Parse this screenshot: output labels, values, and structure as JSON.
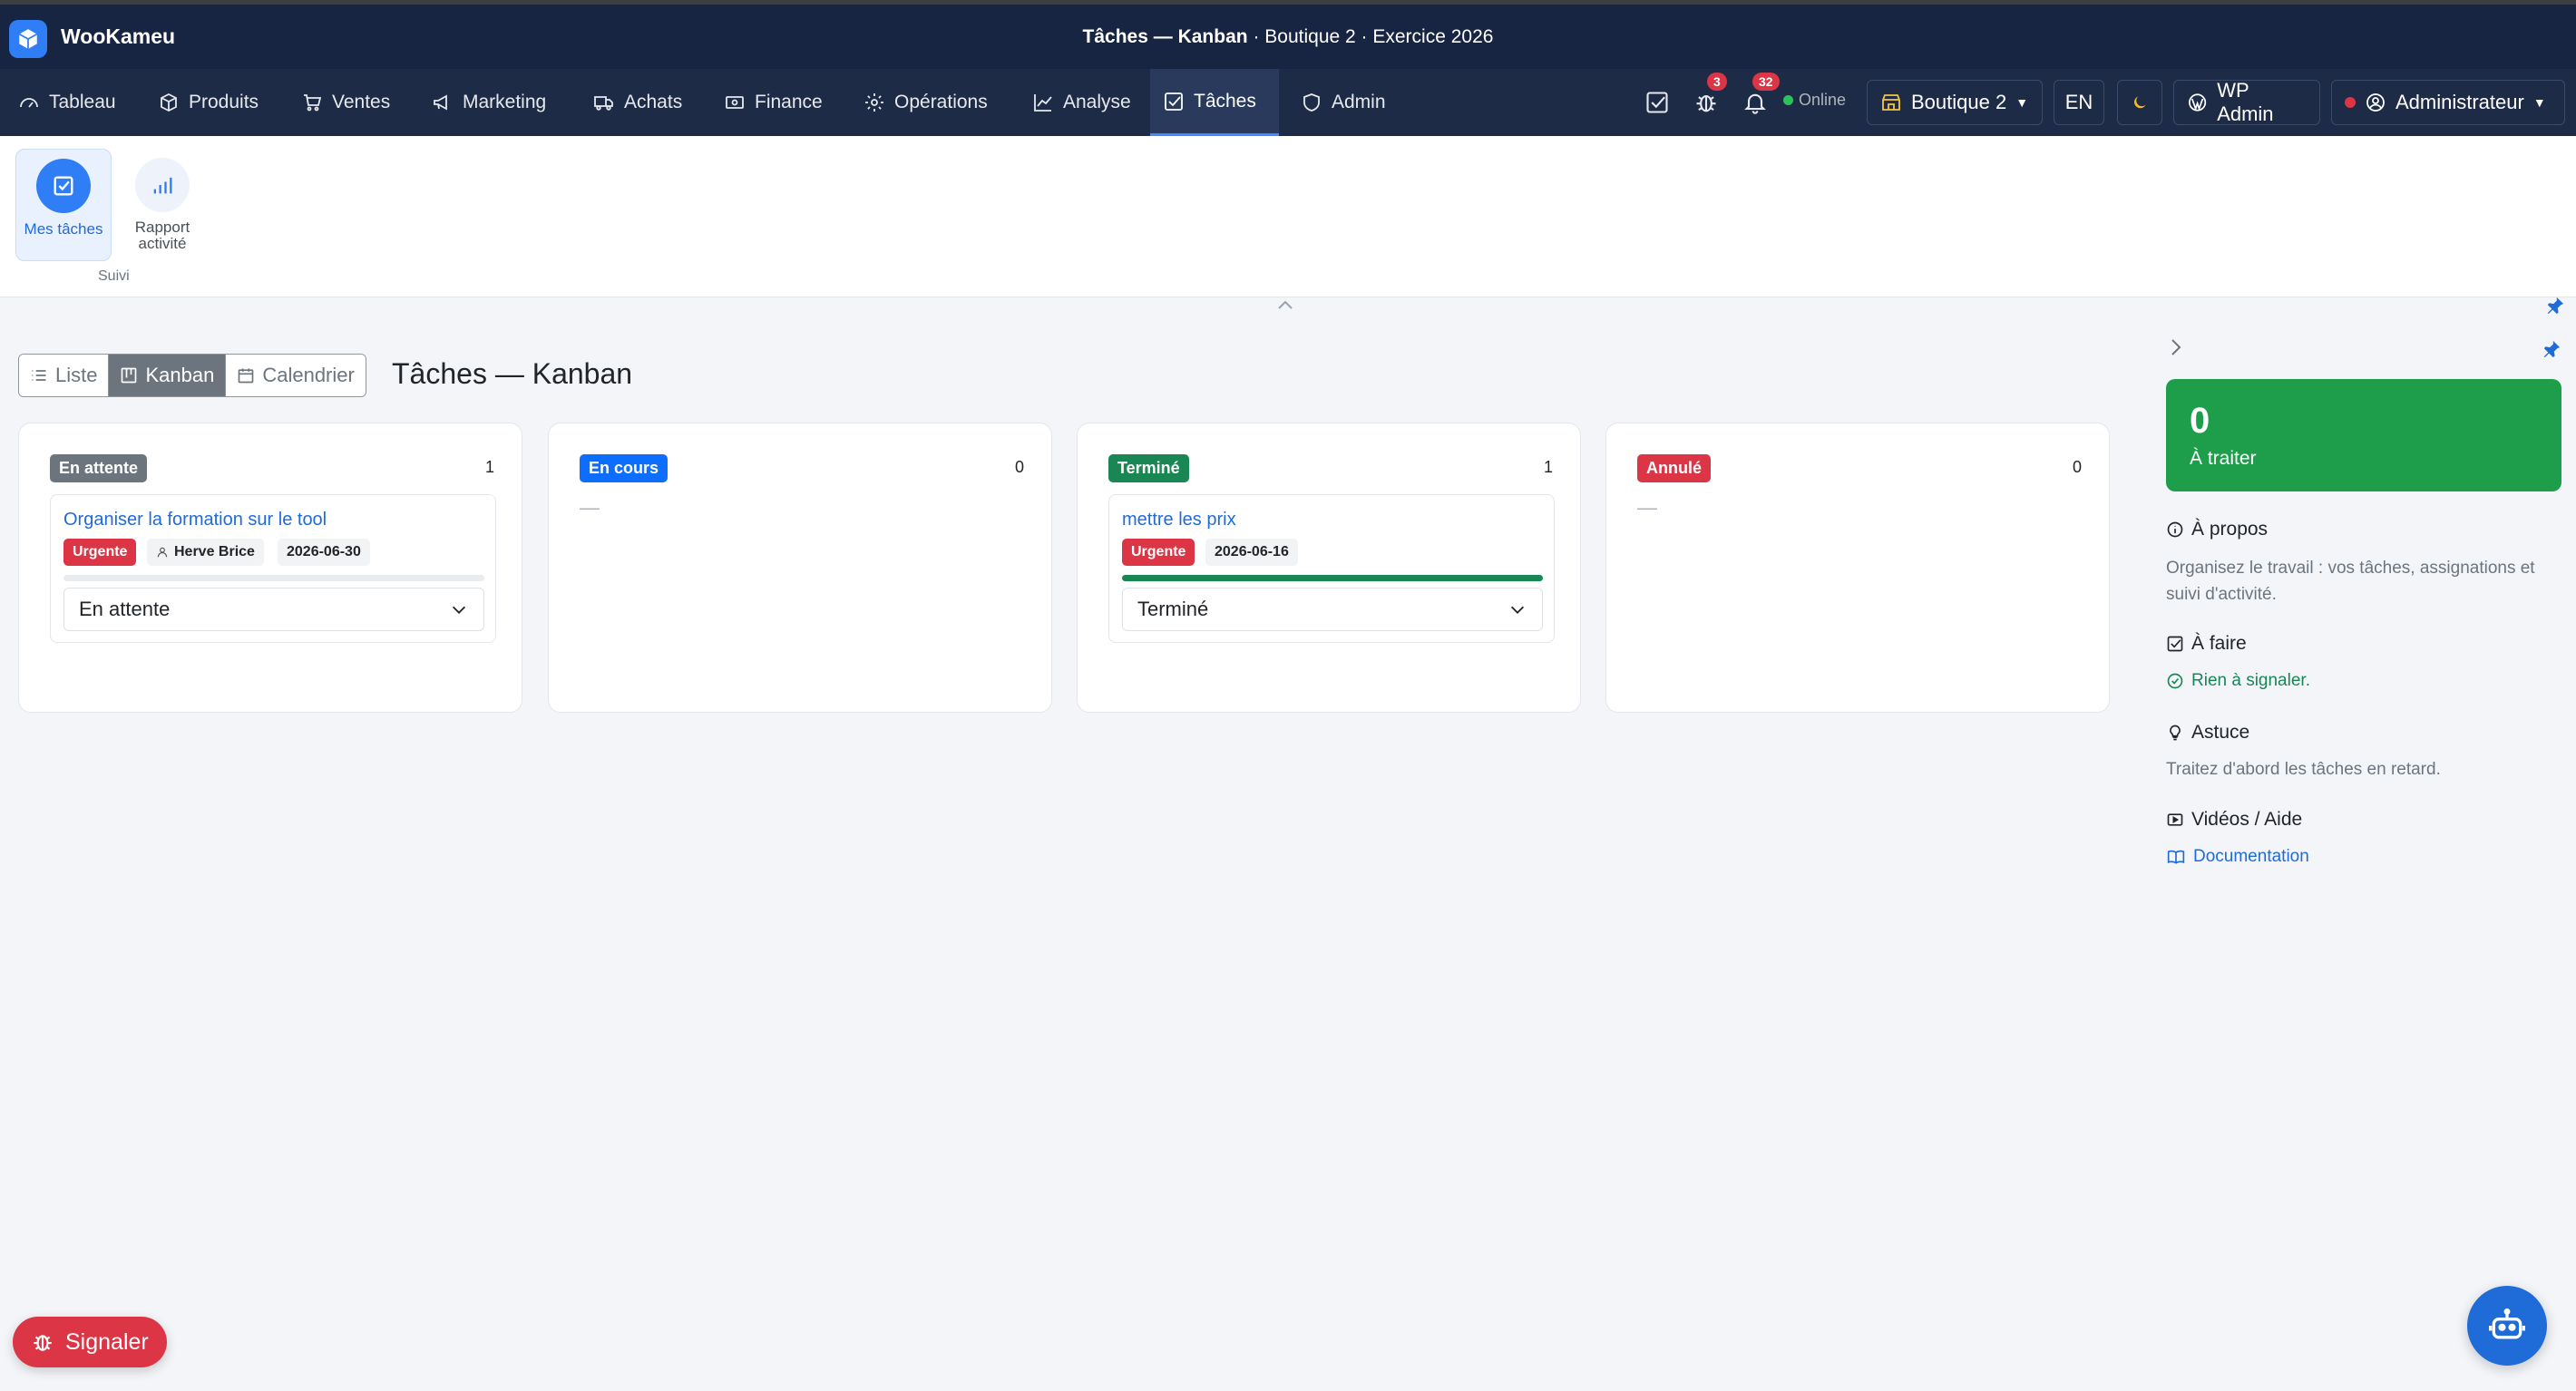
{
  "app": {
    "name": "WooKameu"
  },
  "window": {
    "title_bold": "Tâches — Kanban",
    "title_rest": " · Boutique 2 · Exercice 2026"
  },
  "nav": {
    "items": [
      {
        "label": "Tableau",
        "icon": "gauge-icon"
      },
      {
        "label": "Produits",
        "icon": "box-icon"
      },
      {
        "label": "Ventes",
        "icon": "cart-icon"
      },
      {
        "label": "Marketing",
        "icon": "megaphone-icon"
      },
      {
        "label": "Achats",
        "icon": "truck-icon"
      },
      {
        "label": "Finance",
        "icon": "cash-icon"
      },
      {
        "label": "Opérations",
        "icon": "gear-icon"
      },
      {
        "label": "Analyse",
        "icon": "chart-line-icon"
      },
      {
        "label": "Tâches",
        "icon": "check-square-icon"
      },
      {
        "label": "Admin",
        "icon": "shield-icon"
      }
    ],
    "active": "Tâches",
    "bug_badge": "3",
    "bell_badge": "32",
    "online": "Online",
    "store": "Boutique 2",
    "lang": "EN",
    "wp_admin": "WP Admin",
    "user": "Administrateur"
  },
  "ribbon": {
    "items": [
      {
        "label": "Mes tâches"
      },
      {
        "label": "Rapport activité"
      }
    ],
    "group_label": "Suivi"
  },
  "views": {
    "list": "Liste",
    "kanban": "Kanban",
    "calendar": "Calendrier",
    "active": "Kanban"
  },
  "page_title": "Tâches — Kanban",
  "kanban": {
    "columns": [
      {
        "status": "En attente",
        "count": "1",
        "color": "#6c757d",
        "empty": ""
      },
      {
        "status": "En cours",
        "count": "0",
        "color": "#0d6efd",
        "empty": "—"
      },
      {
        "status": "Terminé",
        "count": "1",
        "color": "#198754",
        "empty": ""
      },
      {
        "status": "Annulé",
        "count": "0",
        "color": "#dc3545",
        "empty": "—"
      }
    ],
    "cards": [
      {
        "title": "Organiser la formation sur le tool",
        "priority": "Urgente",
        "assignee": "Herve Brice",
        "due": "2026-06-30",
        "progress": 0,
        "status": "En attente"
      },
      {
        "title": "mettre les prix",
        "priority": "Urgente",
        "due": "2026-06-16",
        "progress": 100,
        "status": "Terminé"
      }
    ]
  },
  "side": {
    "stat_value": "0",
    "stat_label": "À traiter",
    "about_title": "À propos",
    "about_text": "Organisez le travail : vos tâches, assignations et suivi d'activité.",
    "todo_title": "À faire",
    "todo_text": "Rien à signaler.",
    "tip_title": "Astuce",
    "tip_text": "Traitez d'abord les tâches en retard.",
    "videos_title": "Vidéos / Aide",
    "doc_link": "Documentation"
  },
  "floating": {
    "report": "Signaler"
  },
  "colors": {
    "topbar": "#172542",
    "navbar": "#1e2b46",
    "accent": "#1f6bd8",
    "success": "#1e9e4a",
    "danger": "#dc3545"
  }
}
